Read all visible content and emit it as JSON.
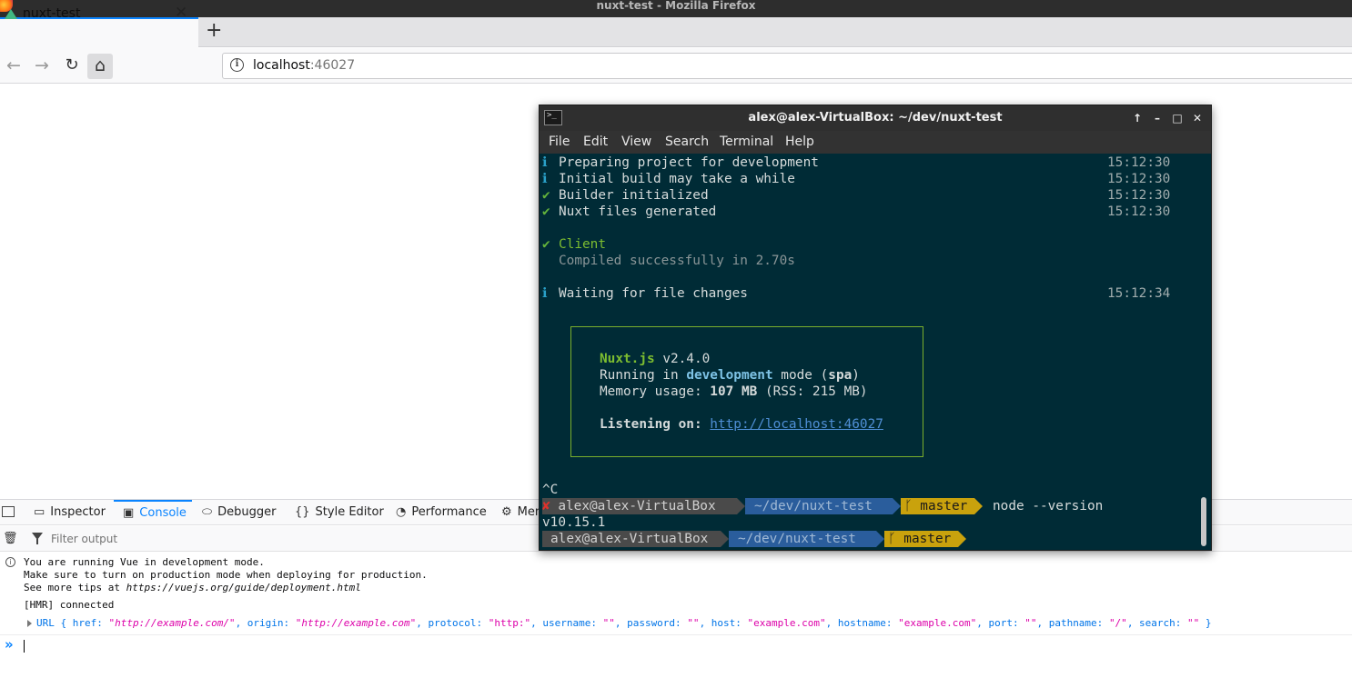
{
  "window": {
    "title": "nuxt-test - Mozilla Firefox"
  },
  "tab": {
    "title": "nuxt-test",
    "close": "✕",
    "new_tab": "+"
  },
  "nav": {
    "back": "←",
    "forward": "→",
    "reload": "↻",
    "home": "⌂"
  },
  "urlbar": {
    "host": "localhost",
    "port": ":46027"
  },
  "devtools": {
    "tabs": {
      "inspector": "Inspector",
      "console": "Console",
      "debugger": "Debugger",
      "style_editor": "Style Editor",
      "performance": "Performance",
      "memory": "Mem"
    },
    "filter_placeholder": "Filter output",
    "console": {
      "vue_line1": "You are running Vue in development mode.",
      "vue_line2": "Make sure to turn on production mode when deploying for production.",
      "vue_line3_prefix": "See more tips at ",
      "vue_line3_url": "https://vuejs.org/guide/deployment.html",
      "hmr": "[HMR] connected",
      "url_object": {
        "label": "URL",
        "href": "\"http://example.com/\"",
        "origin": "\"http://example.com\"",
        "protocol": "\"http:\"",
        "username": "\"\"",
        "password": "\"\"",
        "host": "\"example.com\"",
        "hostname": "\"example.com\"",
        "port": "\"\"",
        "pathname": "\"/\"",
        "search": "\"\""
      }
    }
  },
  "terminal": {
    "title": "alex@alex-VirtualBox: ~/dev/nuxt-test",
    "menu": [
      "File",
      "Edit",
      "View",
      "Search",
      "Terminal",
      "Help"
    ],
    "window_buttons": {
      "up": "↑",
      "minimize": "–",
      "maximize": "□",
      "close": "✕"
    },
    "log": [
      {
        "symbol": "ℹ",
        "text": "Preparing project for development",
        "time": "15:12:30"
      },
      {
        "symbol": "ℹ",
        "text": "Initial build may take a while",
        "time": "15:12:30"
      },
      {
        "symbol": "✔",
        "text": "Builder initialized",
        "time": "15:12:30"
      },
      {
        "symbol": "✔",
        "text": "Nuxt files generated",
        "time": "15:12:30"
      }
    ],
    "client": {
      "symbol": "✔",
      "label": "Client",
      "compiled": "Compiled successfully in 2.70s"
    },
    "waiting": {
      "symbol": "ℹ",
      "text": "Waiting for file changes",
      "time": "15:12:34"
    },
    "box": {
      "name": "Nuxt.js",
      "version": " v2.4.0",
      "running_prefix": "Running in ",
      "mode": "development",
      "mode_mid": " mode (",
      "spa": "spa",
      "mode_end": ")",
      "memory_prefix": "Memory usage: ",
      "memory": "107 MB",
      "rss": " (RSS: 215 MB)",
      "listening_label": "Listening on: ",
      "listening_url": "http://localhost:46027"
    },
    "interrupt": "^C",
    "prompt1": {
      "status": "✘",
      "user": "alex@alex-VirtualBox",
      "dir": "~/dev/nuxt-test",
      "branch": " master",
      "command": "node --version"
    },
    "node_version": "v10.15.1",
    "prompt2": {
      "user": "alex@alex-VirtualBox",
      "dir": "~/dev/nuxt-test",
      "branch": " master"
    }
  }
}
